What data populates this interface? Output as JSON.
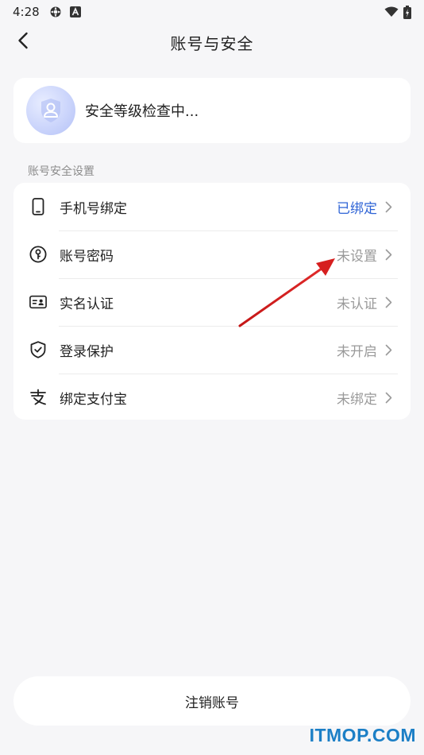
{
  "status_bar": {
    "time": "4:28",
    "icons": [
      "settings-gear-icon",
      "font-a-icon"
    ],
    "right_icons": [
      "wifi-icon",
      "battery-charging-icon"
    ]
  },
  "header": {
    "title": "账号与安全",
    "back_icon": "chevron-left-icon"
  },
  "summary": {
    "text": "安全等级检查中...",
    "icon": "user-shield-icon"
  },
  "section": {
    "label": "账号安全设置"
  },
  "settings": [
    {
      "label": "手机号绑定",
      "status": "已绑定",
      "icon": "phone-icon",
      "active": true
    },
    {
      "label": "账号密码",
      "status": "未设置",
      "icon": "key-icon",
      "active": false
    },
    {
      "label": "实名认证",
      "status": "未认证",
      "icon": "id-card-icon",
      "active": false
    },
    {
      "label": "登录保护",
      "status": "未开启",
      "icon": "shield-check-icon",
      "active": false
    },
    {
      "label": "绑定支付宝",
      "status": "未绑定",
      "icon": "alipay-icon",
      "active": false
    }
  ],
  "footer": {
    "deregister_label": "注销账号"
  },
  "watermark": {
    "text": "ITMOP.COM"
  },
  "colors": {
    "background": "#f6f6f8",
    "card": "#ffffff",
    "bound_status": "#2f64d6",
    "muted_status": "#9a9a9a",
    "annotation_arrow": "#d61f1f",
    "watermark": "#1c7fc6"
  }
}
